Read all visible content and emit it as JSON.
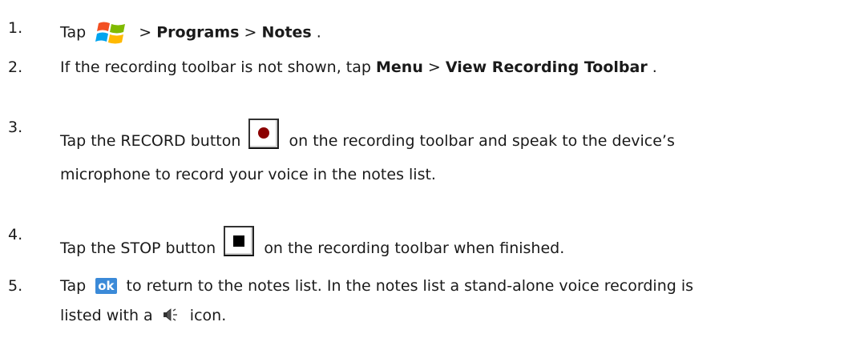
{
  "steps": [
    {
      "number": "1.",
      "text_before_icon": "Tap",
      "icon": "windows-start-icon",
      "sep1": " > ",
      "bold1": "Programs",
      "sep2": " > ",
      "bold2": "Notes",
      "end": "."
    },
    {
      "number": "2.",
      "text": "If the recording toolbar is not shown, tap ",
      "bold1": "Menu",
      "sep": " > ",
      "bold2": "View Recording Toolbar",
      "end": "."
    },
    {
      "number": "3.",
      "text_before_icon": "Tap the RECORD button",
      "icon": "record-button-icon",
      "text_after_icon": "on the recording toolbar and speak to the device’s",
      "line2": "microphone to record your voice in the notes list."
    },
    {
      "number": "4.",
      "text_before_icon": "Tap the STOP button",
      "icon": "stop-button-icon",
      "text_after_icon": "on the recording toolbar when finished."
    },
    {
      "number": "5.",
      "text_before_icon": "Tap",
      "ok_label": "ok",
      "text_after_icon": "to return to the notes list. In the notes list a stand-alone voice recording is",
      "line2_before_icon": "listed with a",
      "icon2": "speaker-icon",
      "line2_after_icon": "icon."
    }
  ],
  "colors": {
    "record_dot": "#8b0000",
    "ok_badge": "#3b8ad8",
    "text": "#1a1a1a"
  }
}
